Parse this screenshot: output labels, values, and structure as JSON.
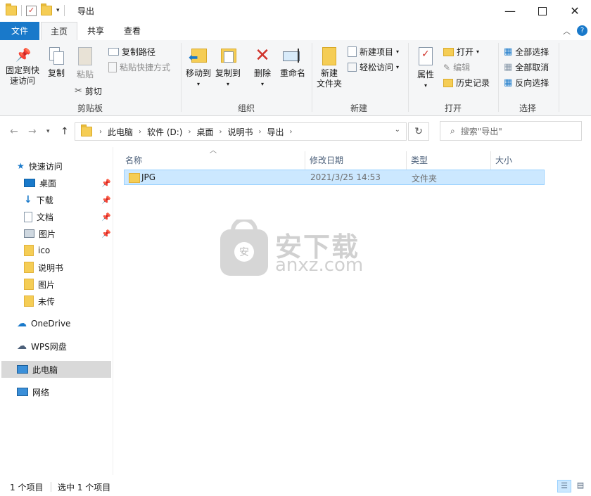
{
  "title": "导出",
  "tabs": {
    "file": "文件",
    "home": "主页",
    "share": "共享",
    "view": "查看"
  },
  "ribbon": {
    "clipboard": {
      "label": "剪贴板",
      "pin": "固定到快\n速访问",
      "pin_l1": "固定到快",
      "pin_l2": "速访问",
      "copy": "复制",
      "paste": "粘贴",
      "copy_path": "复制路径",
      "paste_shortcut": "粘贴快捷方式",
      "cut": "剪切"
    },
    "organize": {
      "label": "组织",
      "move_to": "移动到",
      "copy_to": "复制到",
      "delete": "删除",
      "rename": "重命名"
    },
    "new": {
      "label": "新建",
      "new_folder_l1": "新建",
      "new_folder_l2": "文件夹",
      "new_item": "新建项目",
      "easy_access": "轻松访问"
    },
    "open": {
      "label": "打开",
      "properties": "属性",
      "open": "打开",
      "edit": "编辑",
      "history": "历史记录"
    },
    "select": {
      "label": "选择",
      "select_all": "全部选择",
      "select_none": "全部取消",
      "invert": "反向选择"
    }
  },
  "address": {
    "crumbs": [
      "此电脑",
      "软件 (D:)",
      "桌面",
      "说明书",
      "导出"
    ]
  },
  "search": {
    "placeholder": "搜索\"导出\""
  },
  "navpane": {
    "quick_access": "快速访问",
    "items": [
      "桌面",
      "下载",
      "文档",
      "图片",
      "ico",
      "说明书",
      "图片",
      "未传"
    ],
    "onedrive": "OneDrive",
    "wps": "WPS网盘",
    "this_pc": "此电脑",
    "network": "网络"
  },
  "columns": {
    "name": "名称",
    "date": "修改日期",
    "type": "类型",
    "size": "大小"
  },
  "files": [
    {
      "name": "JPG",
      "date": "2021/3/25 14:53",
      "type": "文件夹",
      "size": ""
    }
  ],
  "watermark": {
    "text": "安下载",
    "domain": "anxz.com"
  },
  "status": {
    "count": "1 个项目",
    "selected": "选中 1 个项目"
  },
  "colors": {
    "accent": "#1979ca",
    "folder": "#f5cd55",
    "selection": "#cce8ff"
  }
}
